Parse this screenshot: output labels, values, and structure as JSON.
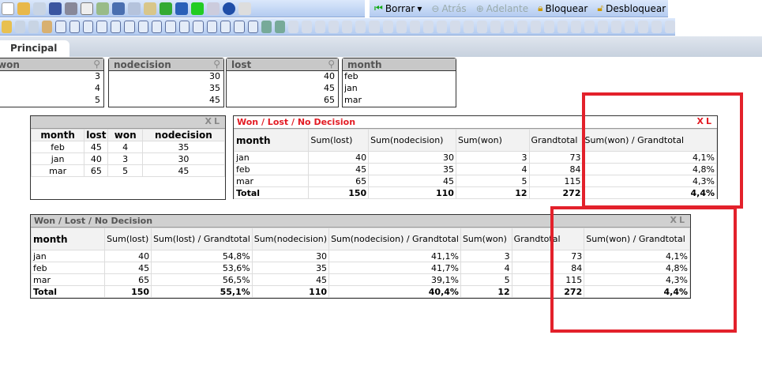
{
  "toolbar1": {
    "borrar": "Borrar",
    "atras": "Atrás",
    "adelante": "Adelante",
    "bloquear": "Bloquear",
    "desbloquear": "Desbloquear"
  },
  "tab": "Principal",
  "listboxes": [
    {
      "title": "won",
      "values": [
        "3",
        "4",
        "5"
      ]
    },
    {
      "title": "nodecision",
      "values": [
        "30",
        "35",
        "45"
      ]
    },
    {
      "title": "lost",
      "values": [
        "40",
        "45",
        "65"
      ]
    },
    {
      "title": "month",
      "values": [
        "feb",
        "jan",
        "mar"
      ]
    }
  ],
  "small_table": {
    "icons": "XL",
    "headers": [
      "month",
      "lost",
      "won",
      "nodecision"
    ],
    "rows": [
      [
        "feb",
        "45",
        "4",
        "35"
      ],
      [
        "jan",
        "40",
        "3",
        "30"
      ],
      [
        "mar",
        "65",
        "5",
        "45"
      ]
    ]
  },
  "pivot": {
    "title": "Won / Lost / No Decision",
    "icons": "XL",
    "headers": [
      "month",
      "Sum(lost)",
      "Sum(nodecision)",
      "Sum(won)",
      "Grandtotal",
      "Sum(won) / Grandtotal"
    ],
    "rows": [
      [
        "jan",
        "40",
        "30",
        "3",
        "73",
        "4,1%"
      ],
      [
        "feb",
        "45",
        "35",
        "4",
        "84",
        "4,8%"
      ],
      [
        "mar",
        "65",
        "45",
        "5",
        "115",
        "4,3%"
      ],
      [
        "Total",
        "150",
        "110",
        "12",
        "272",
        "4,4%"
      ]
    ]
  },
  "bottom": {
    "title": "Won / Lost / No Decision",
    "icons": "XL",
    "headers": [
      "month",
      "Sum(lost)",
      "Sum(lost) / Grandtotal",
      "Sum(nodecision)",
      "Sum(nodecision) / Grandtotal",
      "Sum(won)",
      "Grandtotal",
      "Sum(won) / Grandtotal"
    ],
    "rows": [
      [
        "jan",
        "40",
        "54,8%",
        "30",
        "41,1%",
        "3",
        "73",
        "4,1%"
      ],
      [
        "feb",
        "45",
        "53,6%",
        "35",
        "41,7%",
        "4",
        "84",
        "4,8%"
      ],
      [
        "mar",
        "65",
        "56,5%",
        "45",
        "39,1%",
        "5",
        "115",
        "4,3%"
      ],
      [
        "Total",
        "150",
        "55,1%",
        "110",
        "40,4%",
        "12",
        "272",
        "4,4%"
      ]
    ]
  }
}
